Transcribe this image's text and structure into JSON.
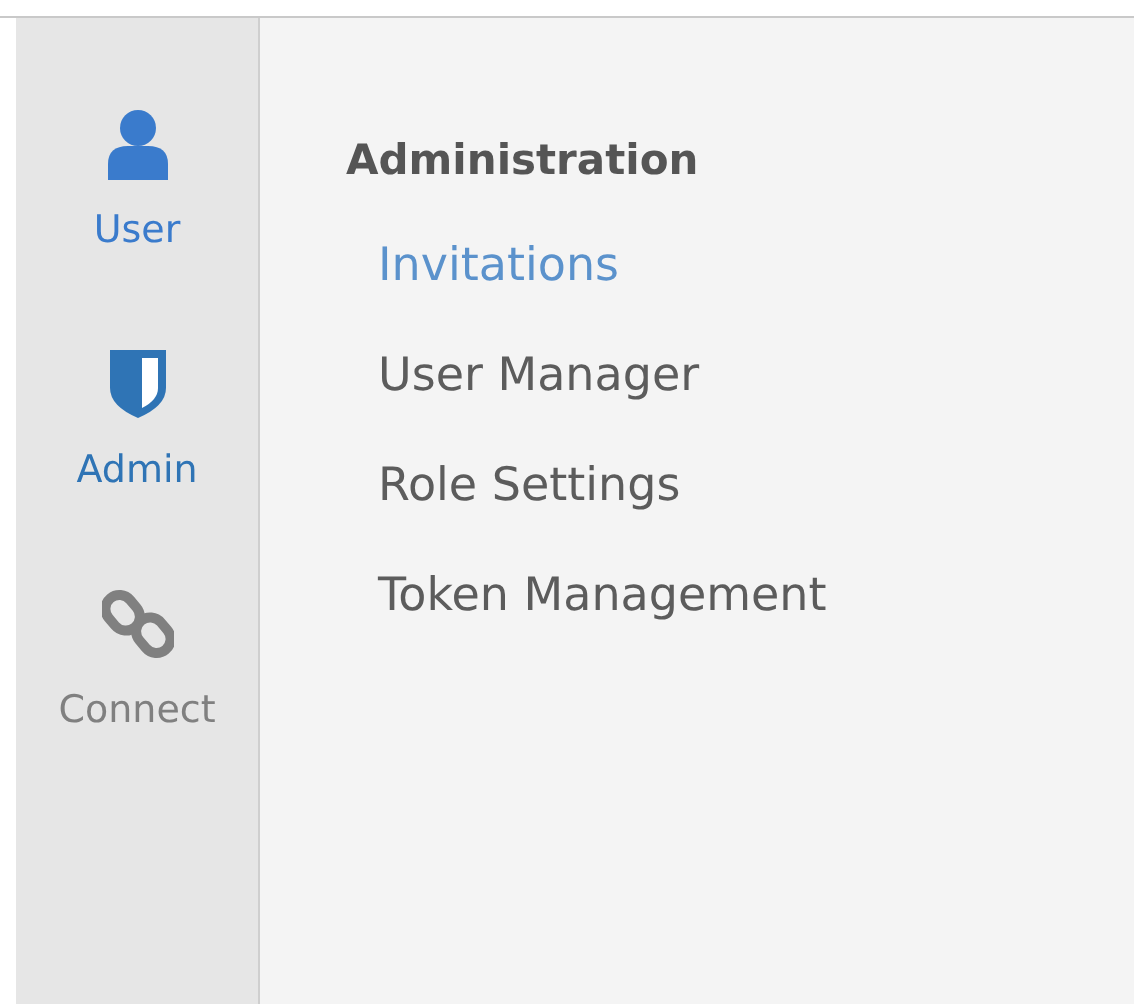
{
  "sidebar": {
    "items": [
      {
        "label": "User",
        "kind": "person",
        "color": "#3a7bcc"
      },
      {
        "label": "Admin",
        "kind": "shield",
        "color": "#2f74b5"
      },
      {
        "label": "Connect",
        "kind": "link",
        "color": "#808080"
      }
    ]
  },
  "menu": {
    "heading": "Administration",
    "items": [
      {
        "label": "Invitations",
        "selected": true
      },
      {
        "label": "User Manager",
        "selected": false
      },
      {
        "label": "Role Settings",
        "selected": false
      },
      {
        "label": "Token Management",
        "selected": false
      }
    ]
  }
}
